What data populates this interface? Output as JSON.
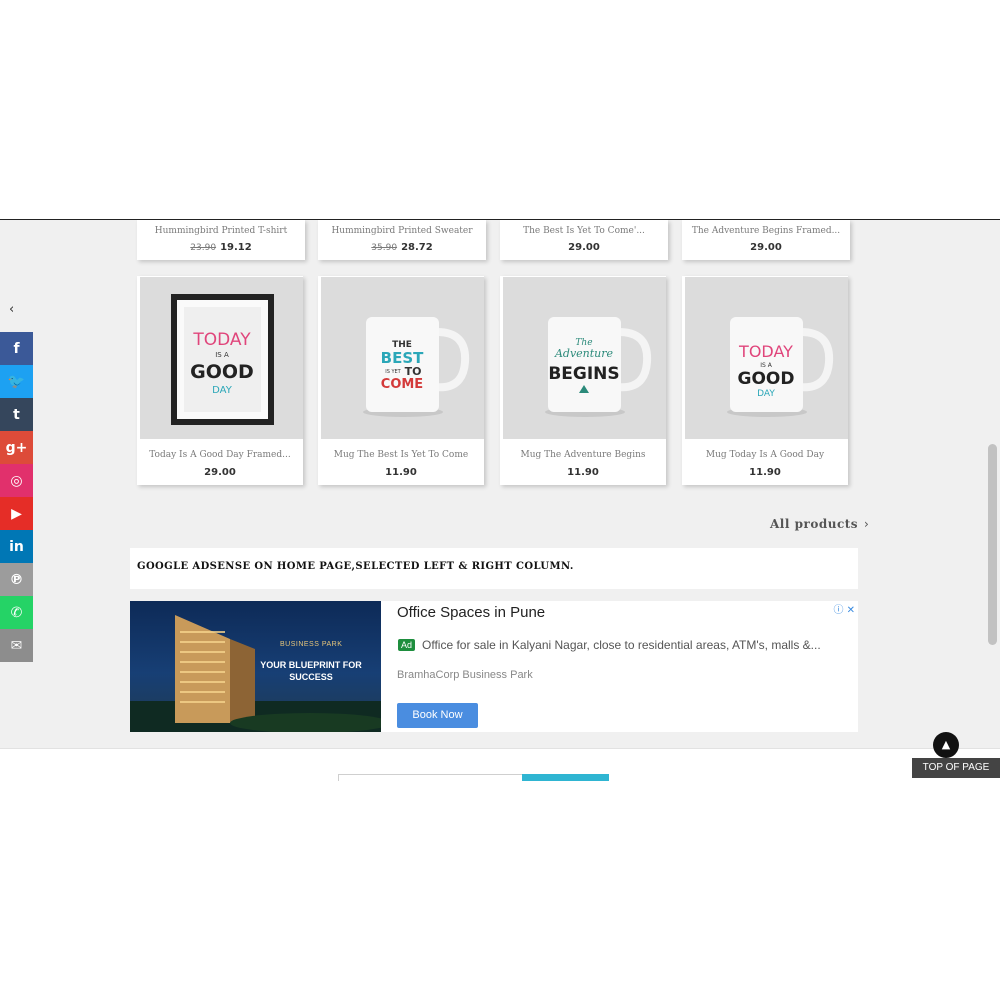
{
  "products_top_row": [
    {
      "name": "Hummingbird Printed T-shirt",
      "old_price": "23.90",
      "price": "19.12"
    },
    {
      "name": "Hummingbird Printed Sweater",
      "old_price": "35.90",
      "price": "28.72"
    },
    {
      "name": "The Best Is Yet To Come'...",
      "old_price": "",
      "price": "29.00"
    },
    {
      "name": "The Adventure Begins Framed...",
      "old_price": "",
      "price": "29.00"
    }
  ],
  "products_second_row": [
    {
      "name": "Today Is A Good Day Framed...",
      "price": "29.00",
      "art": [
        "TODAY",
        "IS A",
        "GOOD",
        "DAY"
      ]
    },
    {
      "name": "Mug The Best Is Yet To Come",
      "price": "11.90",
      "art": [
        "THE",
        "BEST",
        "IS YET",
        "TO",
        "COME"
      ]
    },
    {
      "name": "Mug The Adventure Begins",
      "price": "11.90",
      "art": [
        "The",
        "Adventure",
        "BEGINS"
      ]
    },
    {
      "name": "Mug Today Is A Good Day",
      "price": "11.90",
      "art": [
        "TODAY",
        "IS A",
        "GOOD",
        "DAY"
      ]
    }
  ],
  "all_products_link": "All products",
  "adsense_title": "GOOGLE ADSENSE ON HOME PAGE,SELECTED LEFT & RIGHT COLUMN.",
  "ad": {
    "title": "Office Spaces in Pune",
    "badge": "Ad",
    "description": "Office for sale in Kalyani Nagar, close to residential areas, ATM's, malls &...",
    "company": "BramhaCorp Business Park",
    "button": "Book Now",
    "image_brand": "BUSINESS PARK",
    "image_tagline": "YOUR BLUEPRINT FOR SUCCESS"
  },
  "social": [
    {
      "icon": "facebook-icon",
      "glyph": "f",
      "color": "#3b5998"
    },
    {
      "icon": "twitter-icon",
      "glyph": "🐦",
      "color": "#1da1f2"
    },
    {
      "icon": "tumblr-icon",
      "glyph": "t",
      "color": "#35465c"
    },
    {
      "icon": "google-plus-icon",
      "glyph": "g+",
      "color": "#dd4b39"
    },
    {
      "icon": "instagram-icon",
      "glyph": "◎",
      "color": "#e1306c"
    },
    {
      "icon": "youtube-icon",
      "glyph": "▶",
      "color": "#e52d27"
    },
    {
      "icon": "linkedin-icon",
      "glyph": "in",
      "color": "#0077b5"
    },
    {
      "icon": "pinterest-icon",
      "glyph": "℗",
      "color": "#9c9c9c"
    },
    {
      "icon": "whatsapp-icon",
      "glyph": "✆",
      "color": "#25d366"
    },
    {
      "icon": "email-icon",
      "glyph": "✉",
      "color": "#8d8d8d"
    }
  ],
  "top_of_page": "TOP OF PAGE"
}
